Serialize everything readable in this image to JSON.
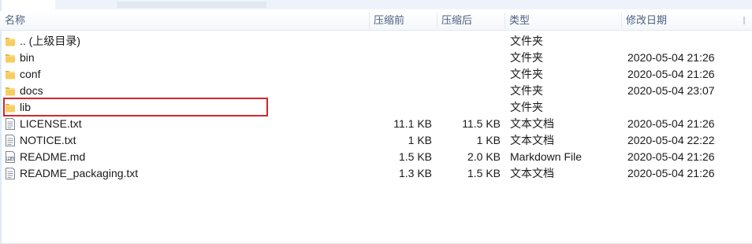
{
  "header": {
    "name": "名称",
    "compressed": "压缩前",
    "original": "压缩后",
    "type": "类型",
    "modified": "修改日期"
  },
  "files": [
    {
      "name": ".. (上级目录)",
      "compressed": "",
      "original": "",
      "type": "文件夹",
      "modified": "",
      "icon": "folder-icon"
    },
    {
      "name": "bin",
      "compressed": "",
      "original": "",
      "type": "文件夹",
      "modified": "2020-05-04 21:26",
      "icon": "folder-icon"
    },
    {
      "name": "conf",
      "compressed": "",
      "original": "",
      "type": "文件夹",
      "modified": "2020-05-04 21:26",
      "icon": "folder-icon"
    },
    {
      "name": "docs",
      "compressed": "",
      "original": "",
      "type": "文件夹",
      "modified": "2020-05-04 23:07",
      "icon": "folder-icon"
    },
    {
      "name": "lib",
      "compressed": "",
      "original": "",
      "type": "文件夹",
      "modified": "",
      "icon": "folder-icon",
      "highlighted": true
    },
    {
      "name": "LICENSE.txt",
      "compressed": "11.1 KB",
      "original": "11.5 KB",
      "type": "文本文档",
      "modified": "2020-05-04 21:26",
      "icon": "text-file-icon"
    },
    {
      "name": "NOTICE.txt",
      "compressed": "1 KB",
      "original": "1 KB",
      "type": "文本文档",
      "modified": "2020-05-04 22:22",
      "icon": "text-file-icon"
    },
    {
      "name": "README.md",
      "compressed": "1.5 KB",
      "original": "2.0 KB",
      "type": "Markdown File",
      "modified": "2020-05-04 21:26",
      "icon": "markdown-file-icon"
    },
    {
      "name": "README_packaging.txt",
      "compressed": "1.3 KB",
      "original": "1.5 KB",
      "type": "文本文档",
      "modified": "2020-05-04 21:26",
      "icon": "text-file-icon"
    }
  ],
  "colors": {
    "folder": "#f5c45a",
    "highlight_border": "#d3282e",
    "header_text": "#4d6080"
  }
}
